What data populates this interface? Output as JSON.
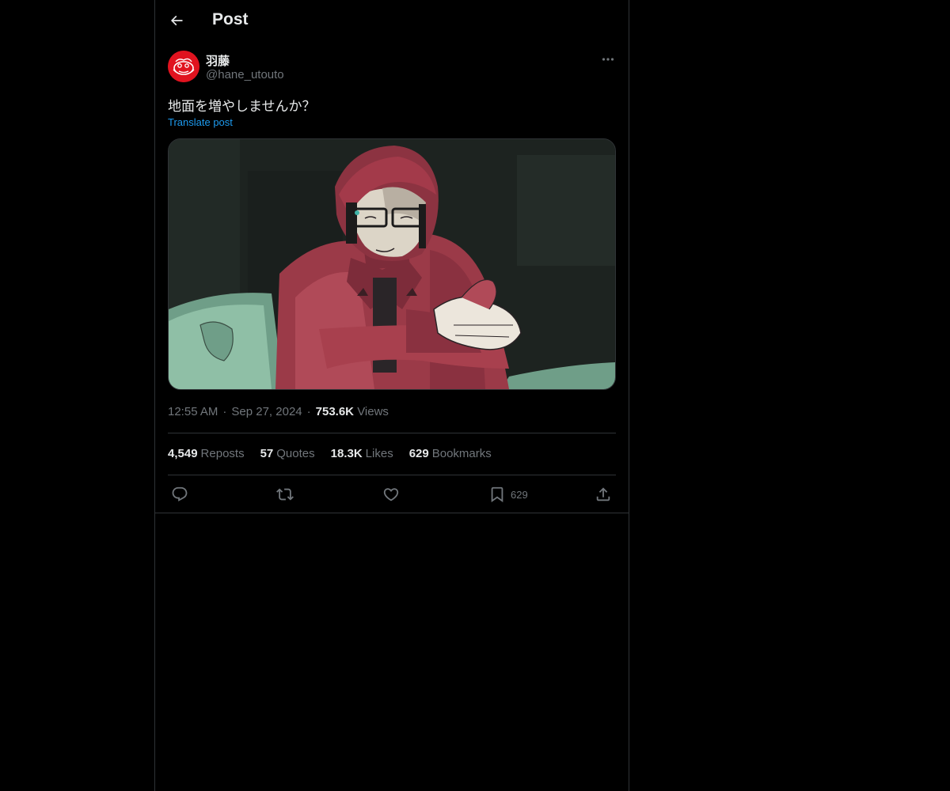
{
  "header": {
    "title": "Post",
    "back_icon": "arrow-left-icon"
  },
  "post": {
    "author": {
      "display_name": "羽藤",
      "handle": "@hane_utouto",
      "avatar_color": "#e0131f"
    },
    "text": "地面を増やしませんか？",
    "translate_label": "Translate post",
    "media": {
      "type": "illustration"
    },
    "time": "12:55 AM",
    "date": "Sep 27, 2024",
    "views_count": "753.6K",
    "views_label": "Views",
    "stats": [
      {
        "count": "4,549",
        "label": "Reposts"
      },
      {
        "count": "57",
        "label": "Quotes"
      },
      {
        "count": "18.3K",
        "label": "Likes"
      },
      {
        "count": "629",
        "label": "Bookmarks"
      }
    ],
    "actions": {
      "reply_icon": "reply-icon",
      "repost_icon": "repost-icon",
      "like_icon": "heart-icon",
      "bookmark_icon": "bookmark-icon",
      "bookmark_count": "629",
      "share_icon": "share-icon"
    }
  },
  "colors": {
    "background": "#000000",
    "text_primary": "#e7e9ea",
    "text_secondary": "#71767b",
    "link": "#1d9bf0",
    "border": "#2f3336"
  }
}
